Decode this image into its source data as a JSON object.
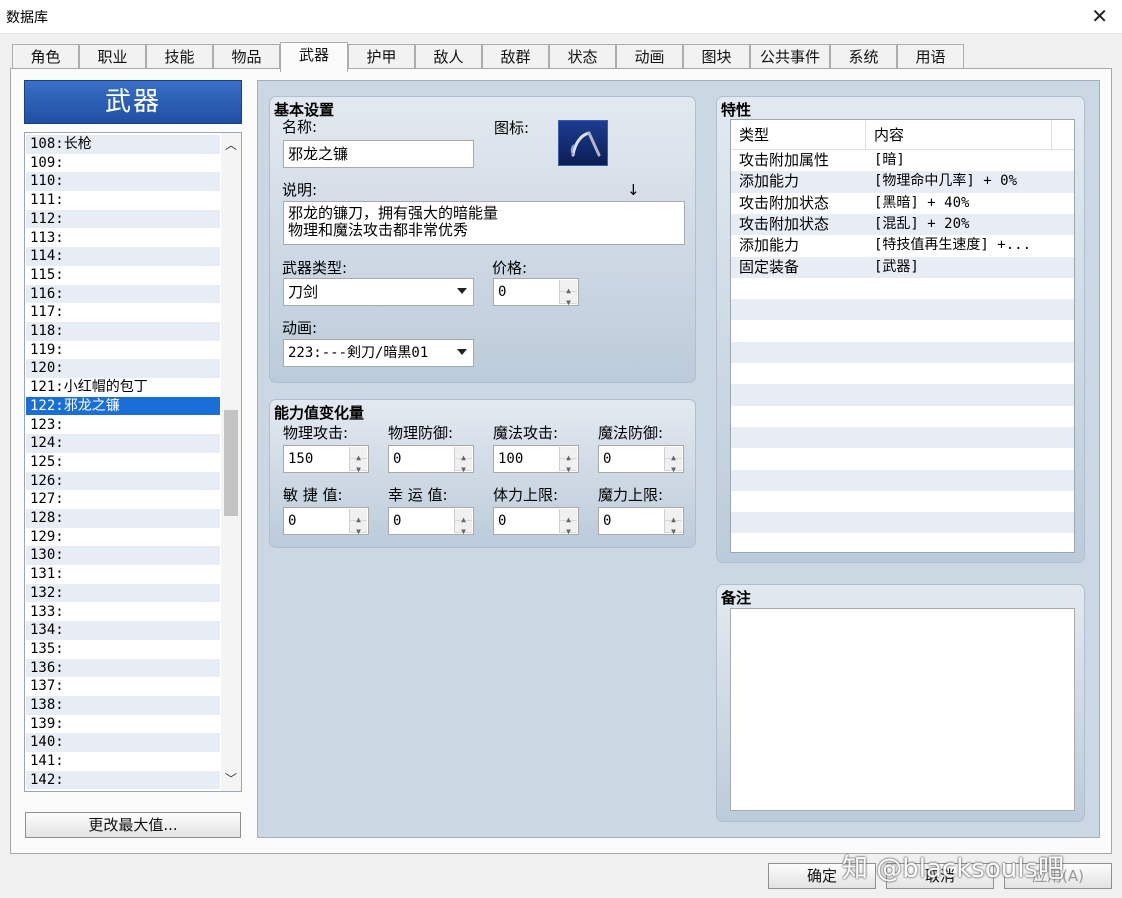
{
  "window": {
    "title": "数据库",
    "close": "✕"
  },
  "tabs": [
    "角色",
    "职业",
    "技能",
    "物品",
    "武器",
    "护甲",
    "敌人",
    "敌群",
    "状态",
    "动画",
    "图块",
    "公共事件",
    "系统",
    "用语"
  ],
  "active_tab": "武器",
  "list": {
    "header": "武器",
    "items": [
      "108:长枪",
      "109:",
      "110:",
      "111:",
      "112:",
      "113:",
      "114:",
      "115:",
      "116:",
      "117:",
      "118:",
      "119:",
      "120:",
      "121:小红帽的包丁",
      "122:邪龙之镰",
      "123:",
      "124:",
      "125:",
      "126:",
      "127:",
      "128:",
      "129:",
      "130:",
      "131:",
      "132:",
      "133:",
      "134:",
      "135:",
      "136:",
      "137:",
      "138:",
      "139:",
      "140:",
      "141:",
      "142:"
    ],
    "selected_index": 14,
    "scroll_fraction": 0.5,
    "change_max_label": "更改最大值..."
  },
  "basic": {
    "title": "基本设置",
    "name_label": "名称:",
    "name_value": "邪龙之镰",
    "icon_label": "图标:",
    "desc_label": "说明:",
    "desc_marker": "↓",
    "desc_line1": "邪龙的镰刀，拥有强大的暗能量",
    "desc_line2": "物理和魔法攻击都非常优秀",
    "weapon_type_label": "武器类型:",
    "weapon_type_value": "刀剑",
    "price_label": "价格:",
    "price_value": "0",
    "animation_label": "动画:",
    "animation_value": "223:---剣刀/暗黒01"
  },
  "params": {
    "title": "能力值变化量",
    "items": [
      {
        "label": "物理攻击:",
        "value": "150"
      },
      {
        "label": "物理防御:",
        "value": "0"
      },
      {
        "label": "魔法攻击:",
        "value": "100"
      },
      {
        "label": "魔法防御:",
        "value": "0"
      },
      {
        "label": "敏 捷 值:",
        "value": "0"
      },
      {
        "label": "幸 运 值:",
        "value": "0"
      },
      {
        "label": "体力上限:",
        "value": "0"
      },
      {
        "label": "魔力上限:",
        "value": "0"
      }
    ]
  },
  "traits": {
    "title": "特性",
    "col_type": "类型",
    "col_content": "内容",
    "rows": [
      {
        "type": "攻击附加属性",
        "content": "[暗]"
      },
      {
        "type": "添加能力",
        "content": "[物理命中几率] + 0%"
      },
      {
        "type": "攻击附加状态",
        "content": "[黑暗] + 40%"
      },
      {
        "type": "攻击附加状态",
        "content": "[混乱] + 20%"
      },
      {
        "type": "添加能力",
        "content": "[特技值再生速度] +..."
      },
      {
        "type": "固定装备",
        "content": "[武器]"
      }
    ]
  },
  "notes": {
    "title": "备注",
    "value": ""
  },
  "footer": {
    "ok": "确定",
    "cancel": "取消",
    "apply": "应用(A)"
  },
  "watermark": "知 @blacksouls吧"
}
